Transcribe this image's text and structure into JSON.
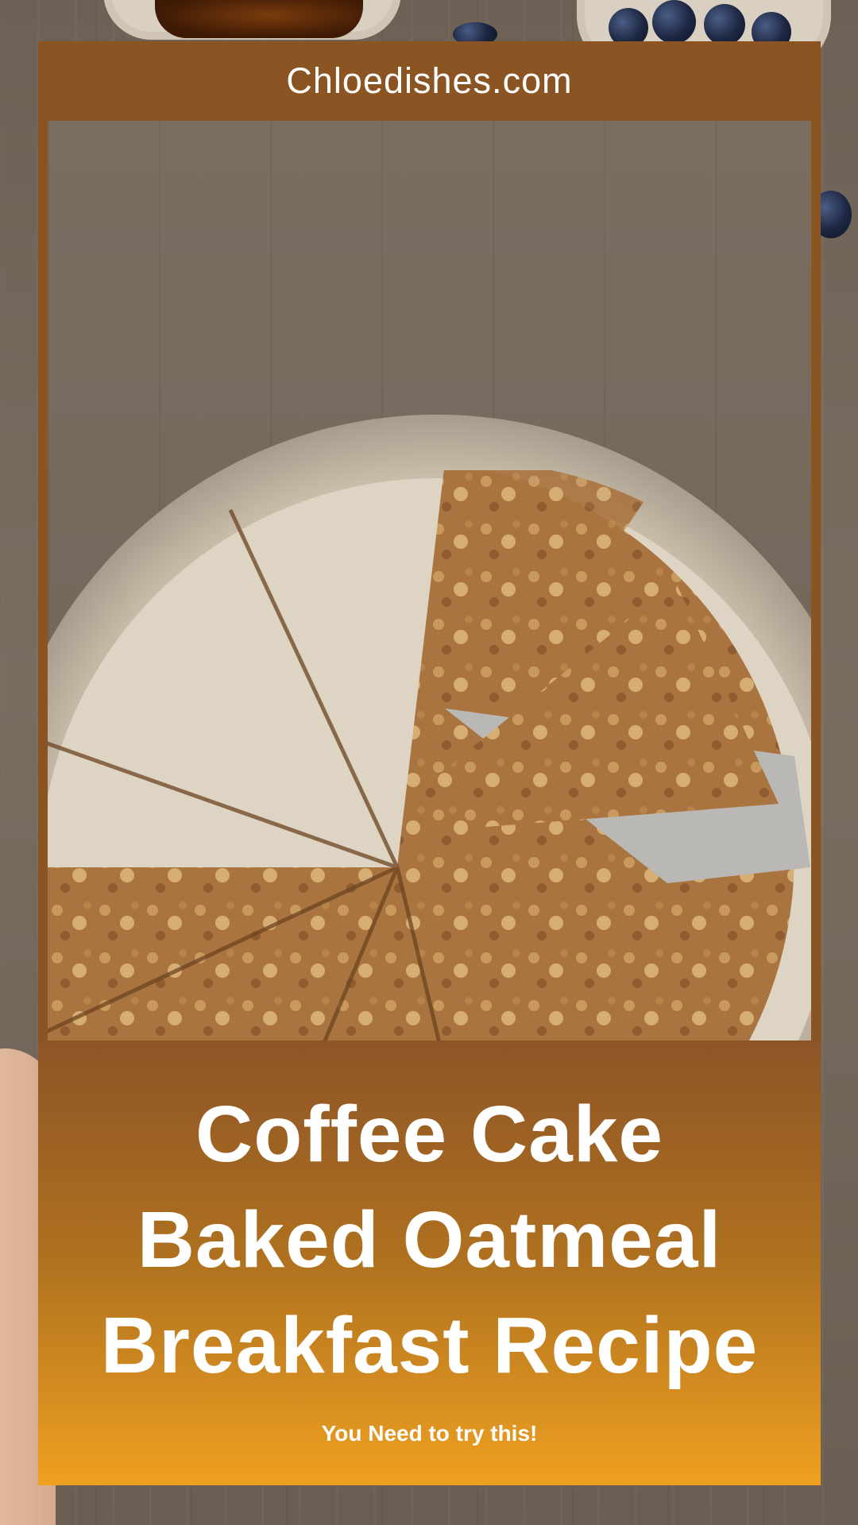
{
  "header": {
    "site_name": "Chloedishes.com"
  },
  "hero": {
    "title_lines": [
      "Coffee Cake",
      "Baked Oatmeal",
      "Breakfast Recipe"
    ],
    "subtitle": "You Need to try this!"
  },
  "colors": {
    "header_band": "#8b5423",
    "panel_top": "#8d5426",
    "panel_bottom": "#efa020",
    "text": "#ffffff"
  }
}
